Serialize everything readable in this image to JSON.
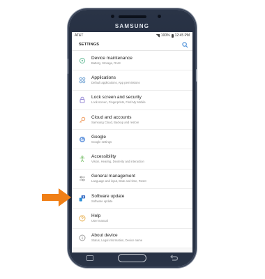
{
  "device": {
    "brand": "SAMSUNG"
  },
  "status_bar": {
    "carrier": "AT&T",
    "battery": "100%",
    "time": "12:45 PM"
  },
  "header": {
    "title": "SETTINGS",
    "search_icon": "search-icon"
  },
  "settings_items": [
    {
      "title": "Device maintenance",
      "subtitle": "Battery, Storage, RAM",
      "icon": "refresh-icon",
      "color": "#7fc6a9"
    },
    {
      "title": "Applications",
      "subtitle": "Default applications, App permissions",
      "icon": "grid-icon",
      "color": "#7ba9d6"
    },
    {
      "title": "Lock screen and security",
      "subtitle": "Lock screen, Fingerprints, Find My Mobile",
      "icon": "lock-icon",
      "color": "#9a8dd6"
    },
    {
      "title": "Cloud and accounts",
      "subtitle": "Samsung Cloud, Backup and restore",
      "icon": "key-icon",
      "color": "#f0a36b"
    },
    {
      "title": "Google",
      "subtitle": "Google settings",
      "icon": "google-icon",
      "color": "#6f9de0"
    },
    {
      "title": "Accessibility",
      "subtitle": "Vision, Hearing, Dexterity and interaction",
      "icon": "accessibility-icon",
      "color": "#8cc77f"
    },
    {
      "title": "General management",
      "subtitle": "Language and input, Date and time, Reset",
      "icon": "sliders-icon",
      "color": "#999999"
    },
    {
      "title": "Software update",
      "subtitle": "Software update",
      "icon": "software-update-icon",
      "color": "#4a78c8"
    },
    {
      "title": "Help",
      "subtitle": "User manual",
      "icon": "help-icon",
      "color": "#e9b55c"
    },
    {
      "title": "About device",
      "subtitle": "Status, Legal information, Device name",
      "icon": "info-icon",
      "color": "#a0a0a0"
    }
  ],
  "annotation": {
    "icon": "pointer-arrow-icon",
    "color": "#f07f16"
  }
}
